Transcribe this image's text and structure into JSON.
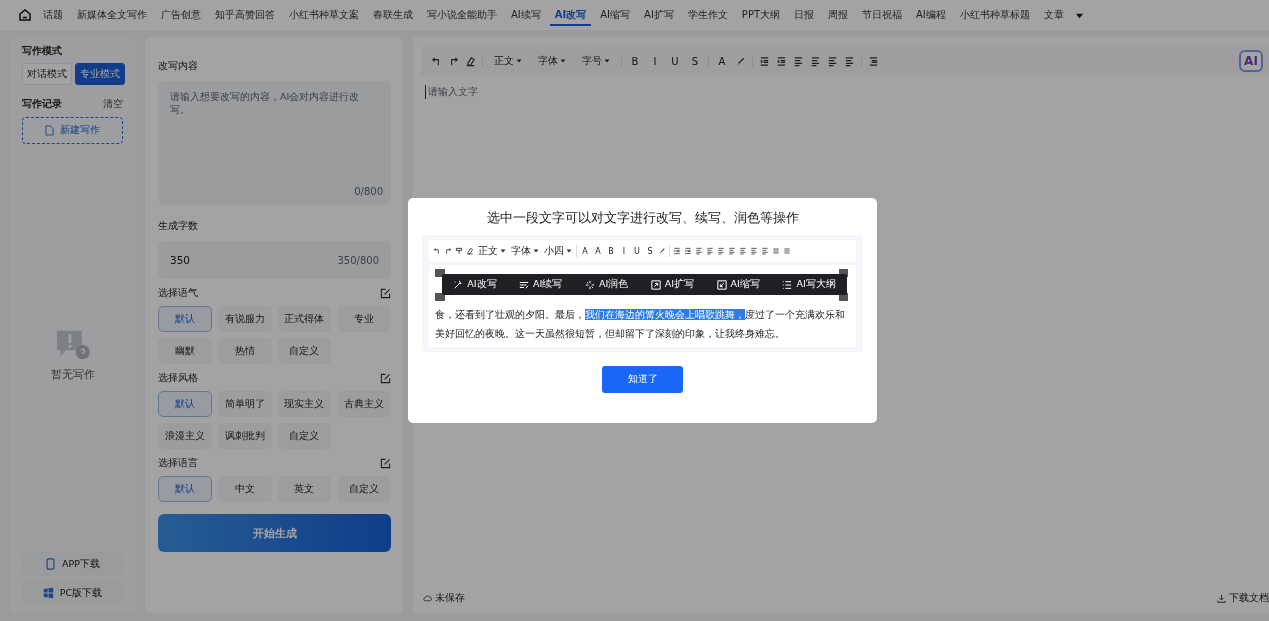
{
  "nav": {
    "tabs": [
      {
        "label": "话题",
        "selected": false
      },
      {
        "label": "新媒体全文写作",
        "selected": false
      },
      {
        "label": "广告创意",
        "selected": false
      },
      {
        "label": "知乎高赞回答",
        "selected": false
      },
      {
        "label": "小红书种草文案",
        "selected": false
      },
      {
        "label": "春联生成",
        "selected": false
      },
      {
        "label": "写小说全能助手",
        "selected": false
      },
      {
        "label": "AI续写",
        "selected": false
      },
      {
        "label": "AI改写",
        "selected": true
      },
      {
        "label": "AI缩写",
        "selected": false
      },
      {
        "label": "AI扩写",
        "selected": false
      },
      {
        "label": "学生作文",
        "selected": false
      },
      {
        "label": "PPT大纲",
        "selected": false
      },
      {
        "label": "日报",
        "selected": false
      },
      {
        "label": "周报",
        "selected": false
      },
      {
        "label": "节日祝福",
        "selected": false
      },
      {
        "label": "AI编程",
        "selected": false
      },
      {
        "label": "小红书种草标题",
        "selected": false
      },
      {
        "label": "文章",
        "selected": false
      }
    ]
  },
  "sidebar": {
    "mode_title": "写作模式",
    "modes": [
      {
        "label": "对话模式",
        "selected": false
      },
      {
        "label": "专业模式",
        "selected": true
      }
    ],
    "records_title": "写作记录",
    "clear": "清空",
    "new_button": "新建写作",
    "empty_text": "暂无写作",
    "downloads": [
      {
        "kind": "phone",
        "label": "APP下载"
      },
      {
        "kind": "windows",
        "label": "PC版下载"
      }
    ]
  },
  "form": {
    "content_label": "改写内容",
    "content_placeholder": "请输入想要改写的内容，AI会对内容进行改写。",
    "content_count": "0/800",
    "length_label": "生成字数",
    "length_value": "350",
    "length_count": "350/800",
    "groups": [
      {
        "title": "选择语气",
        "options": [
          {
            "label": "默认",
            "selected": true
          },
          {
            "label": "有说服力",
            "selected": false
          },
          {
            "label": "正式得体",
            "selected": false
          },
          {
            "label": "专业",
            "selected": false
          },
          {
            "label": "幽默",
            "selected": false
          },
          {
            "label": "热情",
            "selected": false
          },
          {
            "label": "自定义",
            "selected": false
          }
        ]
      },
      {
        "title": "选择风格",
        "options": [
          {
            "label": "默认",
            "selected": true
          },
          {
            "label": "简单明了",
            "selected": false
          },
          {
            "label": "现实主义",
            "selected": false
          },
          {
            "label": "古典主义",
            "selected": false
          },
          {
            "label": "浪漫主义",
            "selected": false
          },
          {
            "label": "讽刺批判",
            "selected": false
          },
          {
            "label": "自定义",
            "selected": false
          }
        ]
      },
      {
        "title": "选择语言",
        "options": [
          {
            "label": "默认",
            "selected": true
          },
          {
            "label": "中文",
            "selected": false
          },
          {
            "label": "英文",
            "selected": false
          },
          {
            "label": "自定义",
            "selected": false
          }
        ]
      }
    ],
    "submit": "开始生成"
  },
  "editor": {
    "toolbar": [
      {
        "kind": "undo"
      },
      {
        "kind": "redo"
      },
      {
        "kind": "eraser"
      },
      {
        "kind": "sep"
      },
      {
        "kind": "dropdown",
        "label": "正文"
      },
      {
        "kind": "dropdown",
        "label": "字体"
      },
      {
        "kind": "dropdown",
        "label": "字号"
      },
      {
        "kind": "sep"
      },
      {
        "kind": "letter",
        "label": "B"
      },
      {
        "kind": "letter",
        "label": "I"
      },
      {
        "kind": "letter",
        "label": "U"
      },
      {
        "kind": "letter",
        "label": "S"
      },
      {
        "kind": "sep"
      },
      {
        "kind": "letter",
        "label": "A"
      },
      {
        "kind": "marker"
      },
      {
        "kind": "sep"
      },
      {
        "kind": "indent"
      },
      {
        "kind": "outdent"
      },
      {
        "kind": "align"
      },
      {
        "kind": "align"
      },
      {
        "kind": "align"
      },
      {
        "kind": "align"
      },
      {
        "kind": "sep"
      },
      {
        "kind": "spacing"
      }
    ],
    "ai_badge": "AI",
    "placeholder": "请输入文字",
    "status": "未保存",
    "download": "下载文档"
  },
  "dialog": {
    "title": "选中一段文字可以对文字进行改写、续写、润色等操作",
    "mini_toolbar": [
      {
        "kind": "undo"
      },
      {
        "kind": "redo"
      },
      {
        "kind": "painter"
      },
      {
        "kind": "eraser"
      },
      {
        "kind": "dropdown",
        "label": "正文"
      },
      {
        "kind": "dropdown",
        "label": "字体"
      },
      {
        "kind": "dropdown",
        "label": "小四"
      },
      {
        "kind": "sep"
      },
      {
        "kind": "letter",
        "label": "A"
      },
      {
        "kind": "letter",
        "label": "A"
      },
      {
        "kind": "letter",
        "label": "B"
      },
      {
        "kind": "letter",
        "label": "I"
      },
      {
        "kind": "letter",
        "label": "U"
      },
      {
        "kind": "letter",
        "label": "S"
      },
      {
        "kind": "marker"
      },
      {
        "kind": "sep"
      },
      {
        "kind": "indent"
      },
      {
        "kind": "outdent"
      },
      {
        "kind": "align"
      },
      {
        "kind": "align"
      },
      {
        "kind": "align"
      },
      {
        "kind": "align"
      },
      {
        "kind": "align"
      },
      {
        "kind": "align"
      },
      {
        "kind": "align"
      },
      {
        "kind": "list"
      },
      {
        "kind": "list"
      }
    ],
    "popup": [
      {
        "kind": "rewrite",
        "label": "AI改写"
      },
      {
        "kind": "continue",
        "label": "AI续写"
      },
      {
        "kind": "polish",
        "label": "AI润色"
      },
      {
        "kind": "expand",
        "label": "AI扩写"
      },
      {
        "kind": "shrink",
        "label": "AI缩写"
      },
      {
        "kind": "outline",
        "label": "AI写大纲"
      }
    ],
    "text_before": "食，还看到了壮观的夕阳。最后，",
    "highlight": "我们在海边的篝火晚会上唱歌跳舞，",
    "text_after": "度过了一个充满欢乐和美好回忆的夜晚。这一天虽然很短暂，但却留下了深刻的印象，让我终身难忘。",
    "confirm": "知道了"
  }
}
